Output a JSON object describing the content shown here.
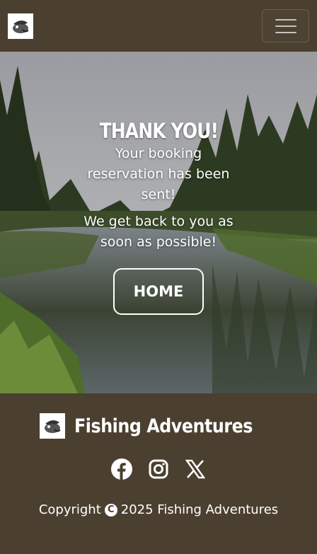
{
  "navbar": {
    "logo_icon": "fish-logo-icon",
    "menu_icon": "hamburger-menu-icon"
  },
  "hero": {
    "title": "THANK YOU!",
    "message": "Your booking reservation has been sent!",
    "message2": "We get back to you as soon as possible!",
    "button_label": "HOME"
  },
  "footer": {
    "brand_name": "Fishing Adventures",
    "social_icons": [
      "facebook-icon",
      "instagram-icon",
      "x-icon"
    ],
    "copyright_prefix": "Copyright",
    "copyright_symbol": "C",
    "copyright_text": "2025 Fishing Adventures"
  },
  "colors": {
    "background": "#4b3f30",
    "text": "#ffffff"
  }
}
